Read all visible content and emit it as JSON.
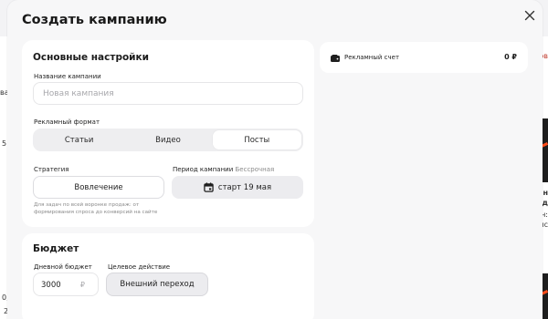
{
  "background": {
    "left_fragments": [
      "ва",
      "5",
      "0,",
      "2"
    ],
    "right_fragments": [
      "ов",
      "ен",
      "од",
      "н:",
      "ис"
    ]
  },
  "modal": {
    "title": "Создать кампанию",
    "close_icon": "close-icon"
  },
  "basic_settings": {
    "title": "Основные настройки",
    "campaign_name": {
      "label": "Название кампании",
      "value": "",
      "placeholder": "Новая кампания"
    },
    "ad_format": {
      "label": "Рекламный формат",
      "options": [
        "Статьи",
        "Видео",
        "Посты"
      ],
      "selected": "Посты"
    },
    "strategy": {
      "label": "Стратегия",
      "value": "Вовлечение",
      "help": "Для задач по всей воронке продаж: от формирования спроса до конверсий на сайте"
    },
    "period": {
      "label": "Период кампании",
      "hint": "Бессрочная",
      "value": "старт 19 мая",
      "icon": "calendar-icon"
    }
  },
  "budget": {
    "title": "Бюджет",
    "daily": {
      "label": "Дневной бюджет",
      "value": "3000",
      "currency": "₽"
    },
    "target_action": {
      "label": "Целевое действие",
      "value": "Внешний переход"
    }
  },
  "account": {
    "label": "Рекламный счет",
    "value": "0 ₽",
    "icon": "wallet-icon"
  },
  "colors": {
    "modal_bg": "#f7f7f8",
    "card_bg": "#ffffff",
    "accent_orange": "#ff4d1a"
  }
}
